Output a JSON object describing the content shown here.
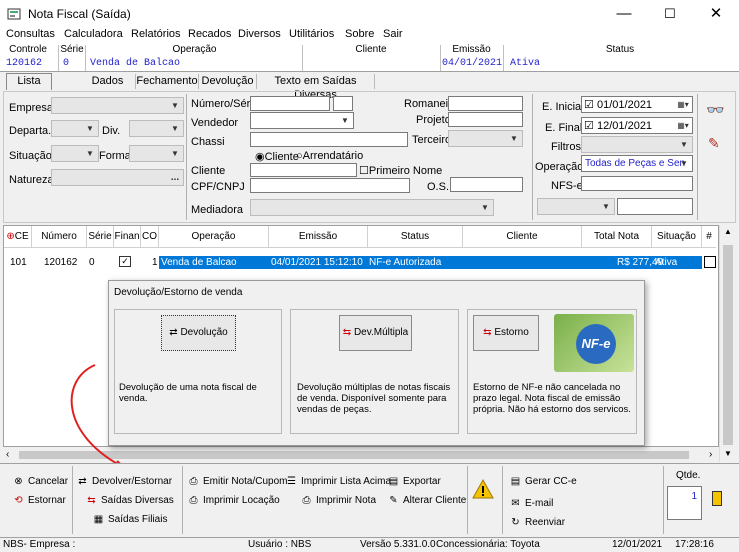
{
  "window": {
    "title": "Nota Fiscal (Saída)",
    "minimize": "—",
    "maximize": "☐",
    "close": "✕"
  },
  "menu": [
    "Consultas",
    "Calculadora",
    "Relatórios",
    "Recados",
    "Diversos",
    "Utilitários",
    "Sobre",
    "Sair"
  ],
  "header": {
    "controle_label": "Controle",
    "controle_value": "120162",
    "serie_label": "Série",
    "serie_value": "0",
    "operacao_label": "Operação",
    "operacao_value": "Venda de Balcao",
    "cliente_label": "Cliente",
    "cliente_value": "",
    "emissao_label": "Emissão",
    "emissao_value": "04/01/2021",
    "ativa_value": "Ativa",
    "status_label": "Status",
    "status_value": ""
  },
  "tabs": [
    "Lista",
    "Dados",
    "Fechamento",
    "Devolução",
    "Texto em Saídas Diversas"
  ],
  "filters": {
    "empresa": "Empresa",
    "departa": "Departa.",
    "div": "Div.",
    "situacao": "Situação",
    "forma": "Forma",
    "natureza": "Natureza",
    "numero_serie": "Número/Série",
    "vendedor": "Vendedor",
    "chassi": "Chassi",
    "radio_cliente": "Cliente",
    "radio_arrendatario": "Arrendatário",
    "cliente": "Cliente",
    "cpf_cnpj": "CPF/CNPJ",
    "mediadora": "Mediadora",
    "romaneio": "Romaneio",
    "projeto": "Projeto",
    "terceiro": "Terceiro",
    "primeiro_nome": "Primeiro Nome",
    "os": "O.S.",
    "e_inicial": "E. Inicial",
    "e_inicial_value": "01/01/2021",
    "e_final": "E. Final",
    "e_final_value": "12/01/2021",
    "filtros": "Filtros",
    "operacao": "Operação",
    "operacao_value": "Todas de Peças e Sen",
    "nfs_e": "NFS-e",
    "ellipsis": "..."
  },
  "grid": {
    "columns": [
      "CE",
      "Número",
      "Série",
      "Finan",
      "CO",
      "Operação",
      "Emissão",
      "Status",
      "Cliente",
      "Total Nota",
      "Situação",
      "#"
    ],
    "rows": [
      {
        "ce": "101",
        "numero": "120162",
        "serie": "0",
        "co": "1",
        "operacao": "Venda de Balcao",
        "emissao": "04/01/2021 15:12:10",
        "status": "NF-e Autorizada",
        "cliente": "",
        "total": "R$ 277,49",
        "situacao": "Ativa"
      }
    ]
  },
  "dialog": {
    "title": "Devolução/Estorno de venda",
    "devolucao_btn": "Devolução",
    "devolucao_text": "Devolução de uma nota fiscal de venda.",
    "dev_multipla_btn": "Dev.Múltipla",
    "dev_multipla_text": "Devolução múltiplas de notas fiscais de venda. Disponível somente para vendas de peças.",
    "estorno_btn": "Estorno",
    "estorno_text": "Estorno de NF-e não cancelada no prazo legal. Nota fiscal de emissão própria. Não há estorno dos servicos.",
    "nfe_logo": "NF-e"
  },
  "bottom": {
    "cancelar": "Cancelar",
    "estornar": "Estornar",
    "devolver": "Devolver/Estornar",
    "saidas_diversas": "Saídas Diversas",
    "saidas_filiais": "Saídas Filiais",
    "emitir_nota": "Emitir Nota/Cupom",
    "imprimir_locacao": "Imprimir Locação",
    "imprimir_lista": "Imprimir Lista Acima",
    "imprimir_nota": "Imprimir Nota",
    "exportar": "Exportar",
    "alterar_cliente": "Alterar Cliente",
    "gerar_cce": "Gerar CC-e",
    "email": "E-mail",
    "reenviar": "Reenviar",
    "qtde_label": "Qtde.",
    "qtde_value": "1"
  },
  "status": {
    "empresa": "NBS- Empresa :",
    "usuario": "Usuário : NBS",
    "versao": "Versão 5.331.0.0",
    "concessionaria": "Concessionária: Toyota",
    "date": "12/01/2021",
    "time": "17:28:16"
  },
  "colors": {
    "accent": "#0078d7",
    "value_blue": "#2222cc",
    "arrow_red": "#e02020"
  }
}
